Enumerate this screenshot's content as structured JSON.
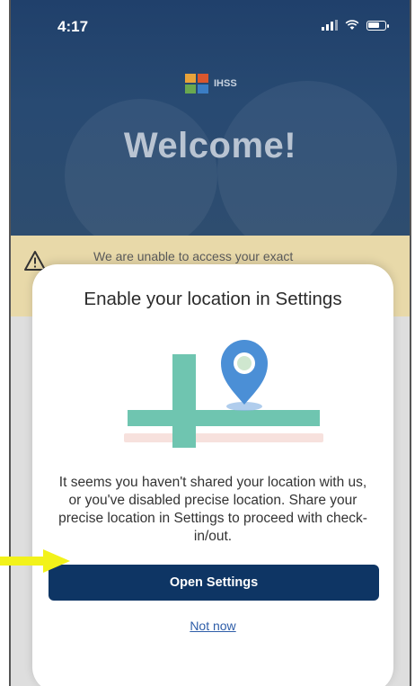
{
  "status_bar": {
    "time": "4:17",
    "icons": [
      "signal-icon",
      "wifi-icon",
      "battery-icon"
    ]
  },
  "header": {
    "logo_text": "IHSS",
    "welcome": "Welcome!"
  },
  "alert": {
    "icon": "warning-icon",
    "text": "We are unable to access your exact"
  },
  "modal": {
    "title": "Enable your location in Settings",
    "illustration": "map-location-pin-icon",
    "body": "It seems you haven't shared your location with us, or you've disabled precise location. Share your precise location in Settings to proceed with check-in/out.",
    "primary_button": "Open Settings",
    "secondary_link": "Not now"
  },
  "annotation": {
    "icon": "yellow-arrow-icon"
  },
  "colors": {
    "header_bg": "#284a72",
    "alert_bg": "#e8d9a9",
    "primary_button_bg": "#0e3564",
    "link": "#2e5da8",
    "pin": "#4b8fd6",
    "map_road": "#6fc5b0",
    "arrow": "#f2f21a"
  }
}
